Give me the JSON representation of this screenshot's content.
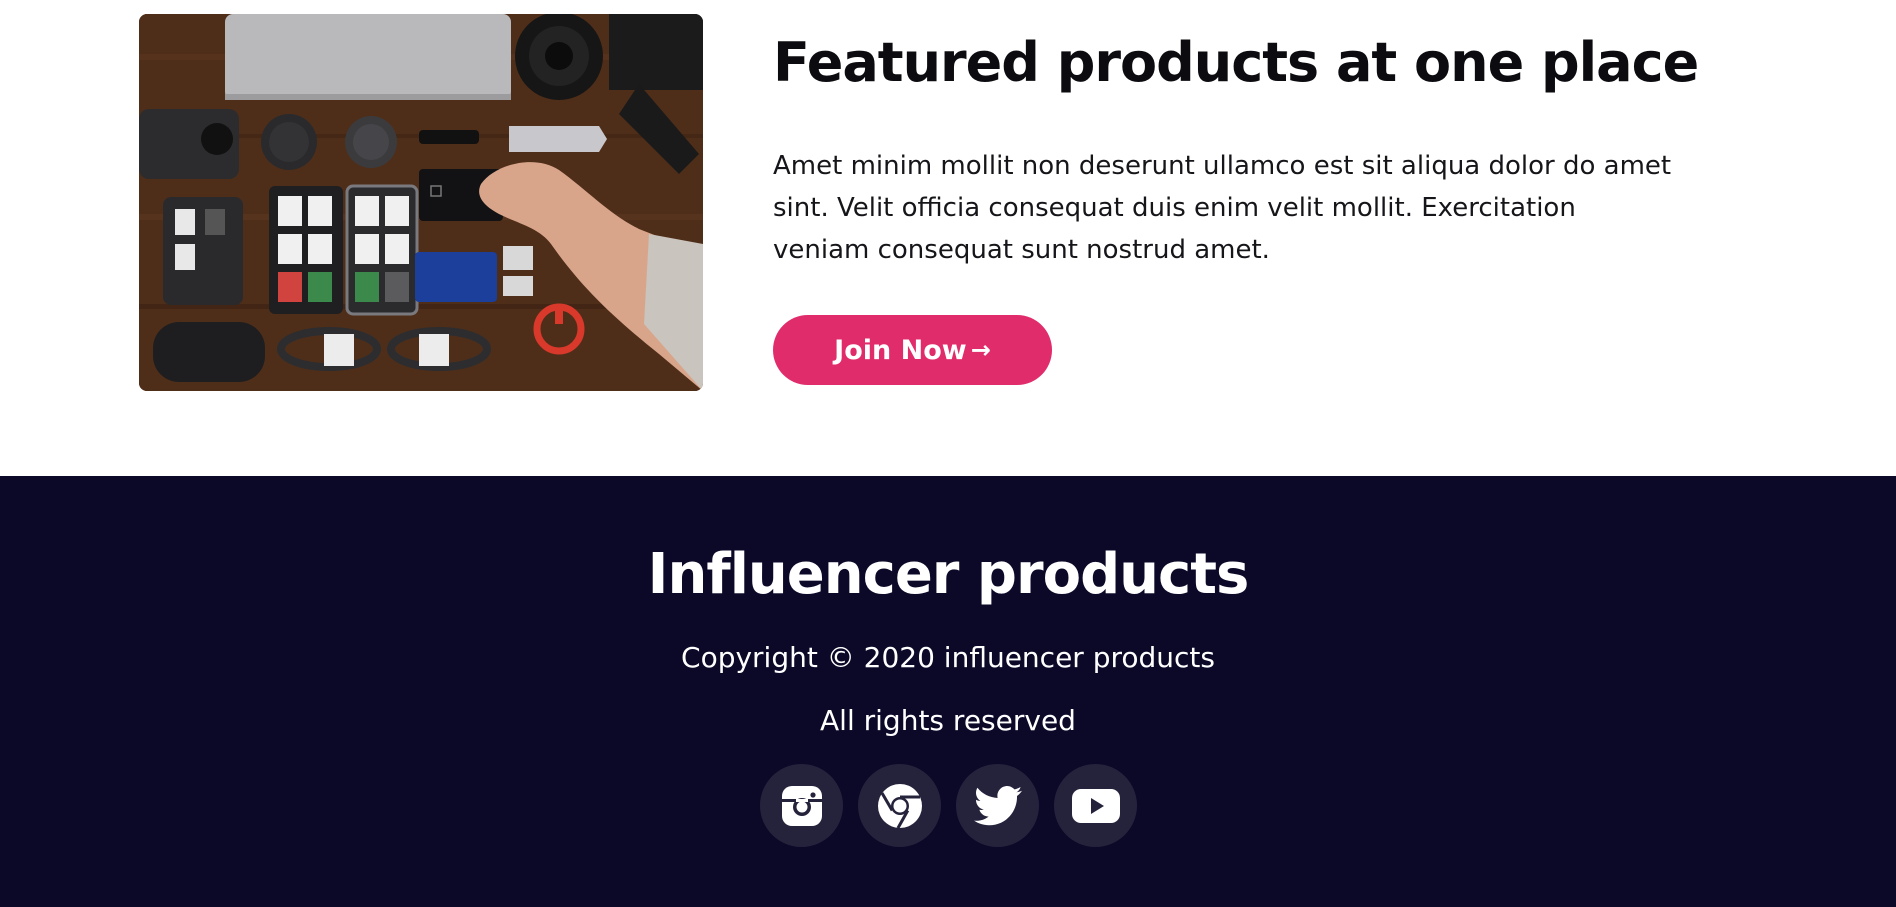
{
  "featured": {
    "title": "Featured products at one place",
    "description": "Amet minim mollit non deserunt ullamco est sit aliqua dolor do amet sint. Velit officia consequat duis enim velit mollit. Exercitation veniam consequat sunt nostrud amet.",
    "button_label": "Join Now",
    "button_arrow": "→",
    "photo_alt": "Top-down view of camera gear, memory cards and a hand holding an SSD on a wooden desk"
  },
  "footer": {
    "title": "Influencer products",
    "copyright": "Copyright © 2020 influencer products",
    "rights": "All rights reserved",
    "socials": [
      {
        "icon": "instagram-icon"
      },
      {
        "icon": "chrome-icon"
      },
      {
        "icon": "twitter-icon"
      },
      {
        "icon": "youtube-icon"
      }
    ]
  },
  "colors": {
    "accent": "#e12c6c",
    "footer_bg": "#0b0828",
    "social_bg": "#25233c",
    "text_dark": "#0b0b10"
  }
}
